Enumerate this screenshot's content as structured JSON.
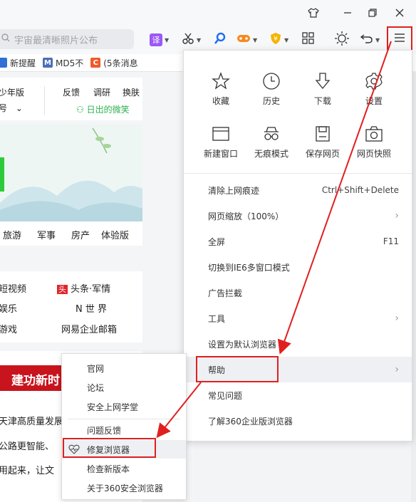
{
  "titlebar": {
    "icons": [
      "shirt-icon",
      "minimize-icon",
      "restore-icon",
      "close-icon"
    ]
  },
  "toolbar": {
    "search_placeholder": "宇宙最清晰照片公布",
    "translate_label": "译",
    "menu_icon": "hamburger-icon"
  },
  "bookmarks": [
    {
      "label": "新提醒",
      "color": "#2f6fd6"
    },
    {
      "label": "MD5不",
      "color": "#3b5bdb"
    },
    {
      "label": "(5条消息",
      "color": "#f05a28"
    }
  ],
  "page": {
    "top_links": [
      "少年版",
      "反馈",
      "调研",
      "换肤"
    ],
    "account_label": "号",
    "wechat_link": "日出的微笑",
    "categories": [
      "旅游",
      "军事",
      "房产",
      "体验版"
    ],
    "news_grid": [
      [
        "短视频",
        "头条·军情"
      ],
      [
        "娱乐",
        "N 世 界"
      ],
      [
        "游戏",
        "网易企业邮箱"
      ]
    ],
    "news_badge": "头",
    "banner_text": "建功新时",
    "headlines": [
      "天津高质量发展",
      "公路更智能、",
      "用起来，让文"
    ]
  },
  "main_menu": {
    "quick": [
      {
        "label": "收藏",
        "icon": "star-icon"
      },
      {
        "label": "历史",
        "icon": "clock-icon"
      },
      {
        "label": "下载",
        "icon": "download-icon"
      },
      {
        "label": "设置",
        "icon": "gear-icon"
      },
      {
        "label": "新建窗口",
        "icon": "window-icon"
      },
      {
        "label": "无痕模式",
        "icon": "incognito-icon"
      },
      {
        "label": "保存网页",
        "icon": "save-icon"
      },
      {
        "label": "网页快照",
        "icon": "camera-icon"
      }
    ],
    "items": [
      {
        "label": "清除上网痕迹",
        "shortcut": "Ctrl+Shift+Delete",
        "arrow": false
      },
      {
        "label": "网页缩放（100%）",
        "shortcut": "",
        "arrow": true
      },
      {
        "label": "全屏",
        "shortcut": "F11",
        "arrow": false
      },
      {
        "label": "切换到IE6多窗口模式",
        "shortcut": "",
        "arrow": false
      },
      {
        "label": "广告拦截",
        "shortcut": "",
        "arrow": false
      },
      {
        "label": "工具",
        "shortcut": "",
        "arrow": true
      },
      {
        "label": "设置为默认浏览器",
        "shortcut": "",
        "arrow": false
      },
      {
        "label": "帮助",
        "shortcut": "",
        "arrow": true
      },
      {
        "label": "常见问题",
        "shortcut": "",
        "arrow": false
      },
      {
        "label": "了解360企业版浏览器",
        "shortcut": "",
        "arrow": false
      }
    ]
  },
  "help_submenu": {
    "items": [
      "官网",
      "论坛",
      "安全上网学堂",
      "问题反馈",
      "修复浏览器",
      "检查新版本",
      "关于360安全浏览器"
    ]
  },
  "colors": {
    "accent_red": "#e02020",
    "banner_red": "#c8141c",
    "green": "#2bb24c"
  }
}
